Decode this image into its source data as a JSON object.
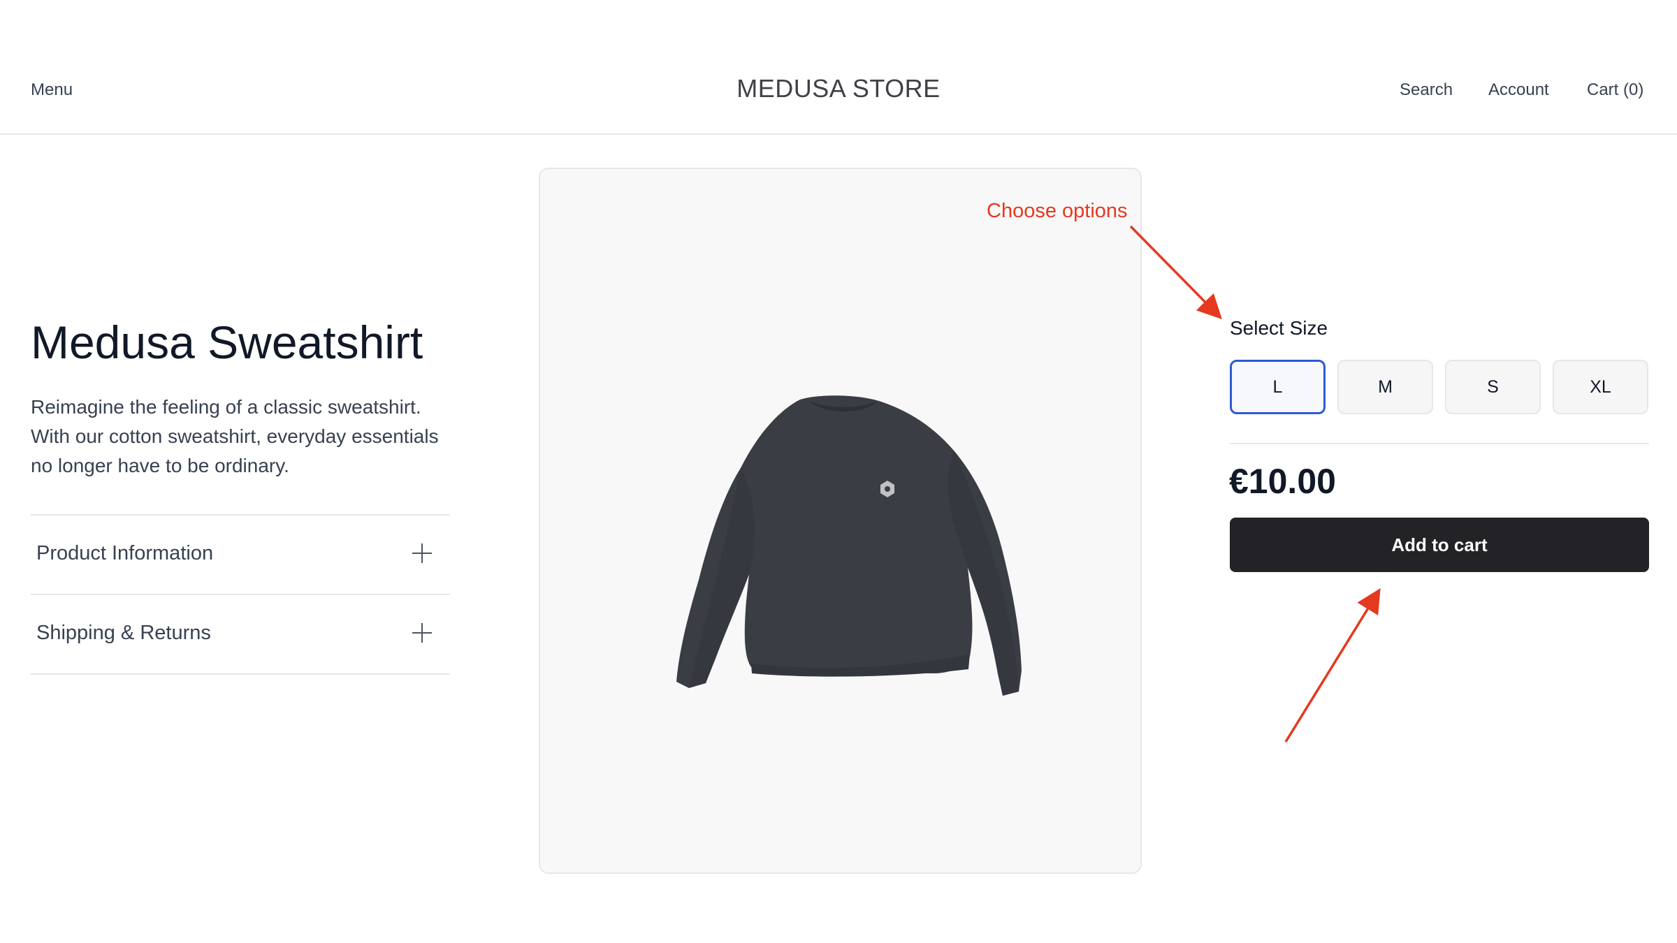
{
  "header": {
    "menu_label": "Menu",
    "brand": "MEDUSA STORE",
    "search_label": "Search",
    "account_label": "Account",
    "cart_label": "Cart (0)"
  },
  "product": {
    "title": "Medusa Sweatshirt",
    "description": "Reimagine the feeling of a classic sweatshirt. With our cotton sweatshirt, everyday essentials no longer have to be ordinary.",
    "image_icon": "sweatshirt-image",
    "accordion": [
      {
        "label": "Product Information",
        "icon": "plus-icon"
      },
      {
        "label": "Shipping & Returns",
        "icon": "plus-icon"
      }
    ]
  },
  "options": {
    "select_label": "Select Size",
    "sizes": [
      "L",
      "M",
      "S",
      "XL"
    ],
    "selected_size": "L",
    "price": "€10.00",
    "add_to_cart_label": "Add to cart"
  },
  "annotations": {
    "choose_options": "Choose options",
    "color": "#e5391f"
  },
  "colors": {
    "accent_selected": "#2d5ad3",
    "button_dark": "#232327",
    "card_bg": "#f8f8f9"
  }
}
